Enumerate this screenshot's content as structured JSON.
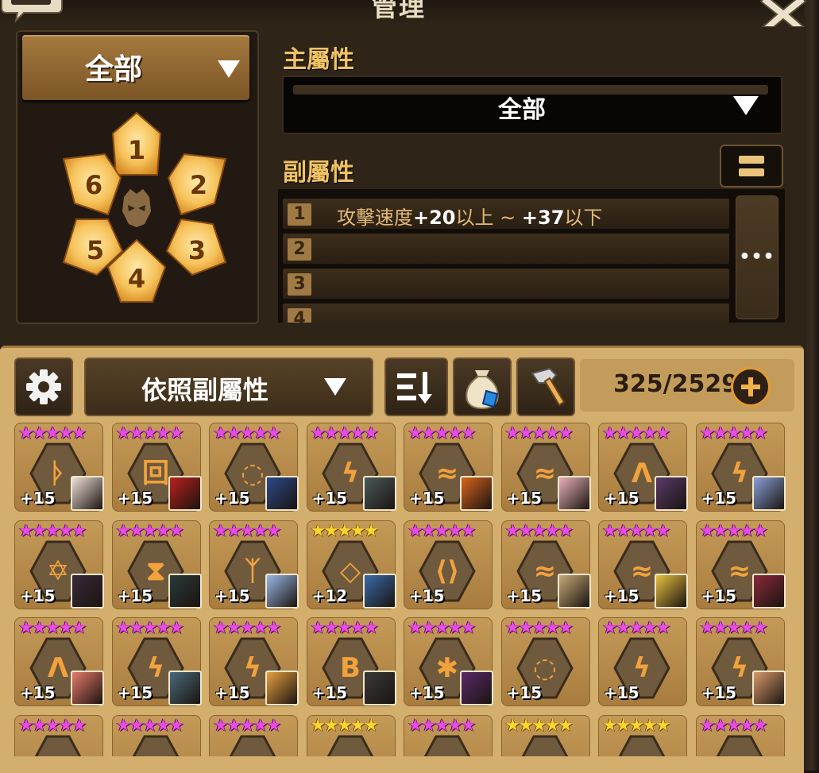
{
  "header": {
    "title": "管理",
    "chat_icon": "chat-bubble-icon",
    "close_icon": "close-icon"
  },
  "rune_set_filter": {
    "selected": "全部",
    "slots": [
      "1",
      "2",
      "3",
      "4",
      "5",
      "6"
    ],
    "center_icon": "monster-mask-icon"
  },
  "main_stat": {
    "label": "主屬性",
    "selected": "全部"
  },
  "sub_stat": {
    "label": "副屬性",
    "rows": [
      {
        "num": "1",
        "stat": "攻擊速度",
        "min": "+20",
        "min_suffix": "以上 ~ ",
        "max": "+37",
        "max_suffix": "以下"
      },
      {
        "num": "2",
        "stat": "",
        "min": "",
        "min_suffix": "",
        "max": "",
        "max_suffix": ""
      },
      {
        "num": "3",
        "stat": "",
        "min": "",
        "min_suffix": "",
        "max": "",
        "max_suffix": ""
      },
      {
        "num": "4",
        "stat": "",
        "min": "",
        "min_suffix": "",
        "max": "",
        "max_suffix": ""
      }
    ],
    "more_label": "•••"
  },
  "toolbar": {
    "sort_selected": "依照副屬性",
    "count": "325/2529"
  },
  "colors": {
    "panel_bg": "#2e2418",
    "inventory_bg": "#d3ae6c",
    "label_gold": "#f0c264",
    "star_legend": "#e94ce6",
    "star_hero": "#ffd531"
  },
  "runes": [
    {
      "stars": "★★★★★",
      "grade": "legend",
      "level": "+15",
      "glyph": "ᚦ",
      "portrait": "#f0e0d8"
    },
    {
      "stars": "★★★★★",
      "grade": "legend",
      "level": "+15",
      "glyph": "回",
      "portrait": "#b8221c"
    },
    {
      "stars": "★★★★★",
      "grade": "legend",
      "level": "+15",
      "glyph": "◌",
      "portrait": "#2c4a8a"
    },
    {
      "stars": "★★★★★",
      "grade": "legend",
      "level": "+15",
      "glyph": "ϟ",
      "portrait": "#4a5a5a"
    },
    {
      "stars": "★★★★★",
      "grade": "legend",
      "level": "+15",
      "glyph": "≈",
      "portrait": "#d8641c"
    },
    {
      "stars": "★★★★★",
      "grade": "legend",
      "level": "+15",
      "glyph": "≈",
      "portrait": "#e8b0b8"
    },
    {
      "stars": "★★★★★",
      "grade": "legend",
      "level": "+15",
      "glyph": "Λ",
      "portrait": "#5a3a6a"
    },
    {
      "stars": "★★★★★",
      "grade": "legend",
      "level": "+15",
      "glyph": "ϟ",
      "portrait": "#8aa0d8"
    },
    {
      "stars": "★★★★★",
      "grade": "legend",
      "level": "+15",
      "glyph": "✡",
      "portrait": "#3a2a3a"
    },
    {
      "stars": "★★★★★",
      "grade": "legend",
      "level": "+15",
      "glyph": "⧗",
      "portrait": "#2a3a3a"
    },
    {
      "stars": "★★★★★",
      "grade": "legend",
      "level": "+15",
      "glyph": "ᛉ",
      "portrait": "#9ab8e8"
    },
    {
      "stars": "★★★★★",
      "grade": "hero",
      "level": "+12",
      "glyph": "◇",
      "portrait": "#3a6aa8"
    },
    {
      "stars": "★★★★★",
      "grade": "legend",
      "level": "+15",
      "glyph": "⟨⟩",
      "portrait": ""
    },
    {
      "stars": "★★★★★",
      "grade": "legend",
      "level": "+15",
      "glyph": "≈",
      "portrait": "#c8a878"
    },
    {
      "stars": "★★★★★",
      "grade": "legend",
      "level": "+15",
      "glyph": "≈",
      "portrait": "#e8c040"
    },
    {
      "stars": "★★★★★",
      "grade": "legend",
      "level": "+15",
      "glyph": "≈",
      "portrait": "#8a2a3a"
    },
    {
      "stars": "★★★★★",
      "grade": "legend",
      "level": "+15",
      "glyph": "Λ",
      "portrait": "#e87a6a"
    },
    {
      "stars": "★★★★★",
      "grade": "legend",
      "level": "+15",
      "glyph": "ϟ",
      "portrait": "#4a6a7a"
    },
    {
      "stars": "★★★★★",
      "grade": "legend",
      "level": "+15",
      "glyph": "ϟ",
      "portrait": "#e8a040"
    },
    {
      "stars": "★★★★★",
      "grade": "legend",
      "level": "+15",
      "glyph": "B",
      "portrait": "#3a3a3a"
    },
    {
      "stars": "★★★★★",
      "grade": "legend",
      "level": "+15",
      "glyph": "✱",
      "portrait": "#5a2a6a"
    },
    {
      "stars": "★★★★★",
      "grade": "legend",
      "level": "+15",
      "glyph": "◌",
      "portrait": ""
    },
    {
      "stars": "★★★★★",
      "grade": "legend",
      "level": "+15",
      "glyph": "ϟ",
      "portrait": ""
    },
    {
      "stars": "★★★★★",
      "grade": "legend",
      "level": "+15",
      "glyph": "ϟ",
      "portrait": "#d89a6a"
    },
    {
      "stars": "★★★★★",
      "grade": "legend",
      "level": "",
      "glyph": "",
      "portrait": ""
    },
    {
      "stars": "★★★★★",
      "grade": "legend",
      "level": "",
      "glyph": "",
      "portrait": ""
    },
    {
      "stars": "★★★★★",
      "grade": "legend",
      "level": "",
      "glyph": "",
      "portrait": ""
    },
    {
      "stars": "★★★★★",
      "grade": "hero",
      "level": "",
      "glyph": "",
      "portrait": ""
    },
    {
      "stars": "★★★★★",
      "grade": "legend",
      "level": "",
      "glyph": "",
      "portrait": ""
    },
    {
      "stars": "★★★★★",
      "grade": "hero",
      "level": "",
      "glyph": "",
      "portrait": ""
    },
    {
      "stars": "★★★★★",
      "grade": "hero",
      "level": "",
      "glyph": "",
      "portrait": ""
    },
    {
      "stars": "★★★★★",
      "grade": "legend",
      "level": "",
      "glyph": "",
      "portrait": ""
    }
  ]
}
